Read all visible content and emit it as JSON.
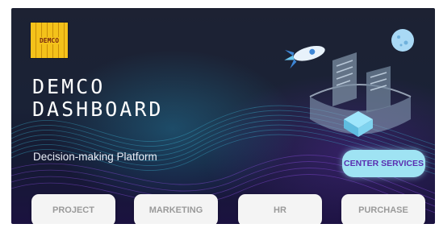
{
  "brand": {
    "logo_text": "DEMCO"
  },
  "hero": {
    "title_line1": "DEMCO",
    "title_line2": "DASHBOARD",
    "subtitle": "Decision-making Platform"
  },
  "actions": {
    "center_services": "CENTER SERVICES"
  },
  "nav": [
    {
      "label": "PROJECT"
    },
    {
      "label": "MARKETING"
    },
    {
      "label": "HR"
    },
    {
      "label": "PURCHASE"
    }
  ],
  "colors": {
    "logo": "#f4c21a",
    "center_button": "#9fe3f3",
    "center_button_text": "#5a2db0",
    "nav_button": "#f4f4f4",
    "nav_text": "#9a9a9a"
  },
  "icons": [
    "rocket-icon",
    "planet-icon",
    "document-icon",
    "hologram-cube-icon"
  ]
}
